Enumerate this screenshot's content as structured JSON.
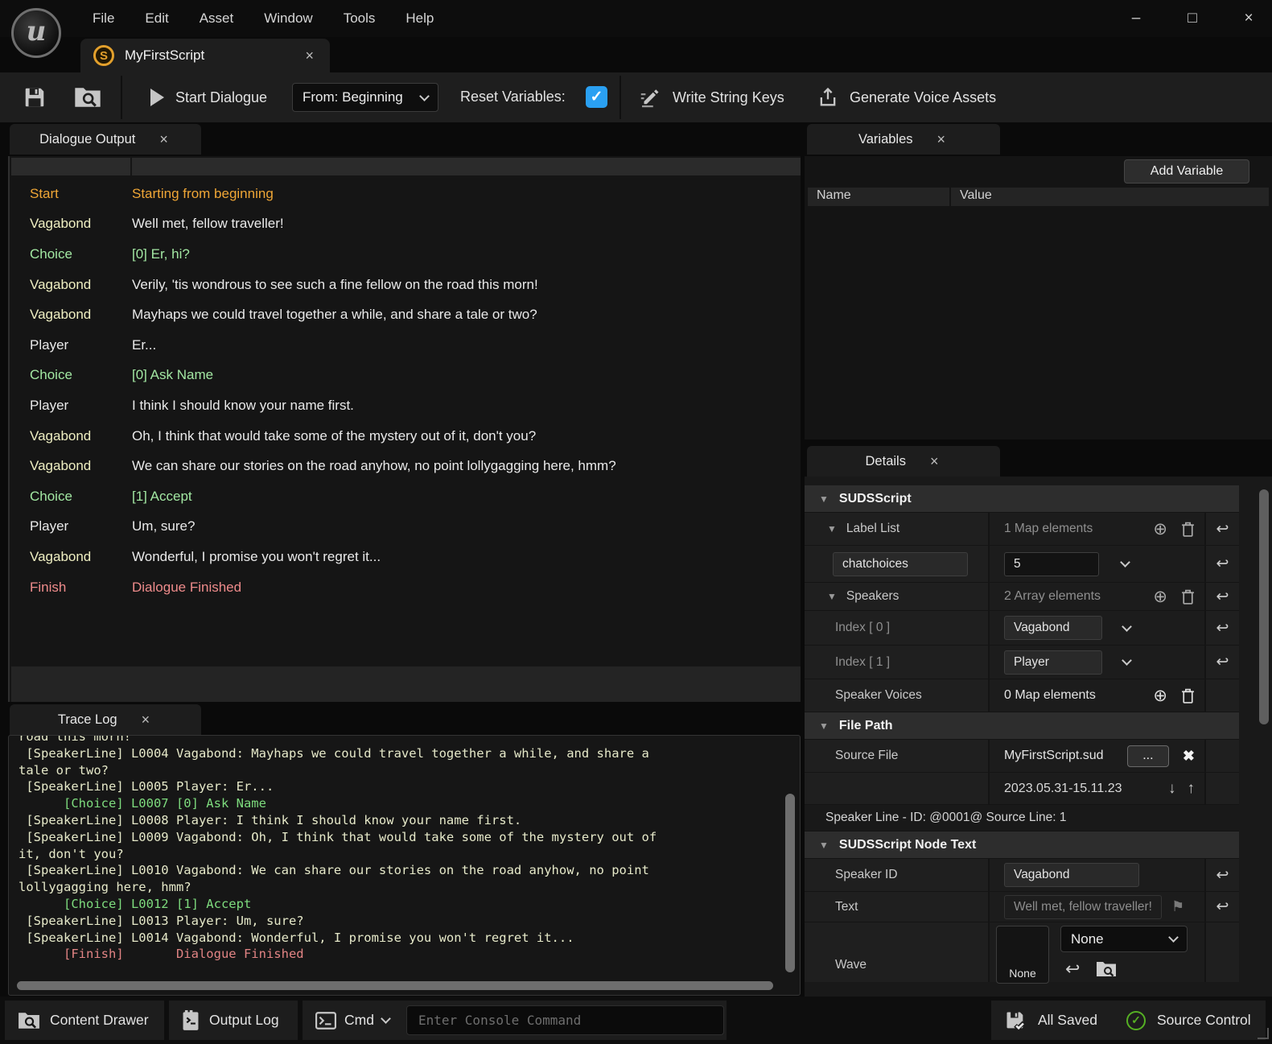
{
  "window": {
    "menu": [
      "File",
      "Edit",
      "Asset",
      "Window",
      "Tools",
      "Help"
    ],
    "asset_tab": "MyFirstScript",
    "controls": {
      "minimize": "–",
      "maximize": "□",
      "close": "×"
    }
  },
  "toolbar": {
    "start_dialogue": "Start Dialogue",
    "from_dropdown": "From: Beginning",
    "reset_variables_label": "Reset Variables:",
    "reset_variables_checked": true,
    "write_string_keys": "Write String Keys",
    "generate_voice_assets": "Generate Voice Assets"
  },
  "dialogue_output": {
    "tab": "Dialogue Output",
    "rows": [
      {
        "speaker": "Start",
        "text": "Starting from beginning",
        "type": "start"
      },
      {
        "speaker": "Vagabond",
        "text": "Well met, fellow traveller!",
        "type": "speech"
      },
      {
        "speaker": "Choice",
        "text": "[0] Er, hi?",
        "type": "choice"
      },
      {
        "speaker": "Vagabond",
        "text": "Verily, 'tis wondrous to see such a fine fellow on the road this morn!",
        "type": "speech"
      },
      {
        "speaker": "Vagabond",
        "text": "Mayhaps we could travel together a while, and share a tale or two?",
        "type": "speech"
      },
      {
        "speaker": "Player",
        "text": "Er...",
        "type": "speech"
      },
      {
        "speaker": "Choice",
        "text": "[0] Ask Name",
        "type": "choice"
      },
      {
        "speaker": "Player",
        "text": "I think I should know your name first.",
        "type": "speech"
      },
      {
        "speaker": "Vagabond",
        "text": "Oh, I think that would take some of the mystery out of it, don't you?",
        "type": "speech"
      },
      {
        "speaker": "Vagabond",
        "text": "We can share our stories on the road anyhow, no point lollygagging here, hmm?",
        "type": "speech"
      },
      {
        "speaker": "Choice",
        "text": "[1] Accept",
        "type": "choice"
      },
      {
        "speaker": "Player",
        "text": "Um, sure?",
        "type": "speech"
      },
      {
        "speaker": "Vagabond",
        "text": "Wonderful, I promise you won't regret it...",
        "type": "speech"
      },
      {
        "speaker": "Finish",
        "text": "Dialogue Finished",
        "type": "finish"
      }
    ]
  },
  "variables": {
    "tab": "Variables",
    "add_button": "Add Variable",
    "columns": {
      "name": "Name",
      "value": "Value"
    }
  },
  "details": {
    "tab": "Details",
    "suds_script_section": "SUDSScript",
    "label_list": {
      "label": "Label List",
      "count": "1 Map elements"
    },
    "chatchoices": {
      "key": "chatchoices",
      "value": "5"
    },
    "speakers": {
      "label": "Speakers",
      "count": "2 Array elements"
    },
    "index0": {
      "label": "Index [ 0 ]",
      "value": "Vagabond"
    },
    "index1": {
      "label": "Index [ 1 ]",
      "value": "Player"
    },
    "speaker_voices": {
      "label": "Speaker Voices",
      "count": "0 Map elements"
    },
    "file_path_section": "File Path",
    "source_file": {
      "label": "Source File",
      "value": "MyFirstScript.sud",
      "browse": "...",
      "timestamp": "2023.05.31-15.11.23"
    },
    "speaker_line_note": "Speaker Line - ID: @0001@  Source Line: 1",
    "node_text_section": "SUDSScript Node Text",
    "speaker_id": {
      "label": "Speaker ID",
      "value": "Vagabond"
    },
    "text": {
      "label": "Text",
      "placeholder": "Well met, fellow traveller!"
    },
    "wave": {
      "label": "Wave",
      "thumb": "None",
      "value": "None"
    }
  },
  "trace_log": {
    "tab": "Trace Log",
    "lines": [
      {
        "text": "road this morn!",
        "type": "normal"
      },
      {
        "text": " [SpeakerLine] L0004 Vagabond: Mayhaps we could travel together a while, and share a",
        "type": "normal"
      },
      {
        "text": "tale or two?",
        "type": "normal"
      },
      {
        "text": " [SpeakerLine] L0005 Player: Er...",
        "type": "normal"
      },
      {
        "text": "      [Choice] L0007 [0] Ask Name",
        "type": "choice"
      },
      {
        "text": " [SpeakerLine] L0008 Player: I think I should know your name first.",
        "type": "normal"
      },
      {
        "text": " [SpeakerLine] L0009 Vagabond: Oh, I think that would take some of the mystery out of",
        "type": "normal"
      },
      {
        "text": "it, don't you?",
        "type": "normal"
      },
      {
        "text": " [SpeakerLine] L0010 Vagabond: We can share our stories on the road anyhow, no point",
        "type": "normal"
      },
      {
        "text": "lollygagging here, hmm?",
        "type": "normal"
      },
      {
        "text": "      [Choice] L0012 [1] Accept",
        "type": "choice"
      },
      {
        "text": " [SpeakerLine] L0013 Player: Um, sure?",
        "type": "normal"
      },
      {
        "text": " [SpeakerLine] L0014 Vagabond: Wonderful, I promise you won't regret it...",
        "type": "normal"
      },
      {
        "text": "      [Finish]       Dialogue Finished",
        "type": "finish"
      }
    ]
  },
  "status_bar": {
    "content_drawer": "Content Drawer",
    "output_log": "Output Log",
    "cmd": "Cmd",
    "console_placeholder": "Enter Console Command",
    "all_saved": "All Saved",
    "source_control": "Source Control"
  },
  "colors": {
    "accent_blue": "#2aa0f2",
    "start_orange": "#efa636",
    "choice_green": "#a2e7a2",
    "speaker_yellow": "#efefc2",
    "finish_red": "#ee8b8b",
    "trace_text": "#e6e9c9",
    "trace_choice": "#7edc7e",
    "trace_finish": "#e28484",
    "source_control_green": "#55b023"
  }
}
